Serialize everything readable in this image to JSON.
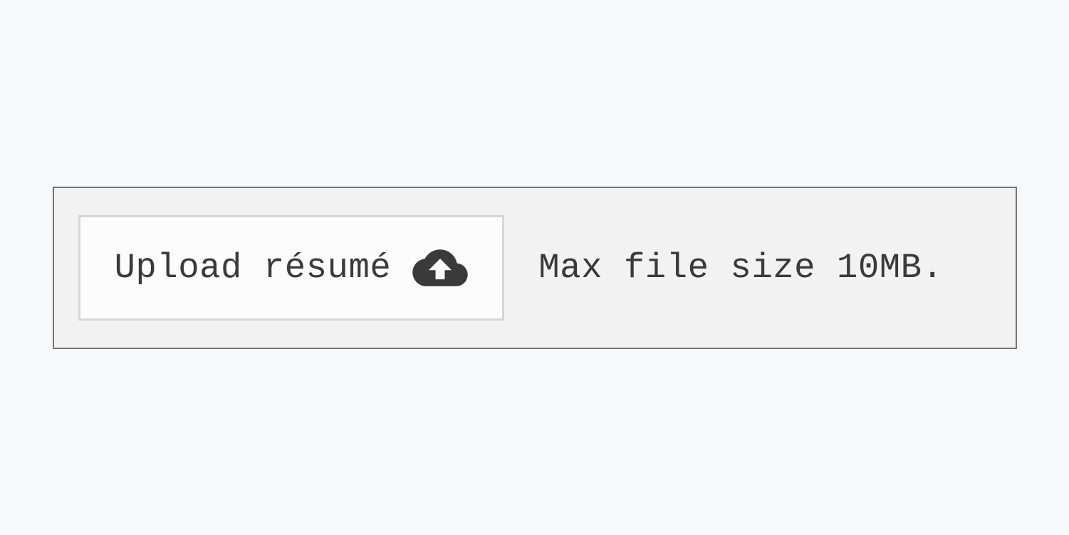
{
  "upload": {
    "button_label": "Upload résumé",
    "hint": "Max file size 10MB.",
    "icon_color": "#3a3a3a"
  }
}
